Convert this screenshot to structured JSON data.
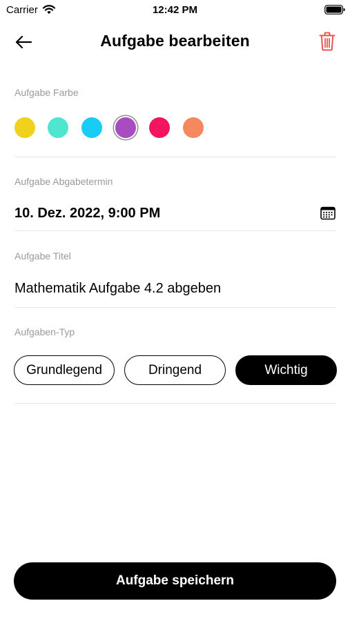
{
  "status_bar": {
    "carrier": "Carrier",
    "time": "12:42 PM"
  },
  "nav": {
    "title": "Aufgabe bearbeiten",
    "back_icon": "arrow-left-icon",
    "delete_icon": "trash-icon",
    "delete_color": "#e8554c"
  },
  "color_section": {
    "label": "Aufgabe Farbe",
    "swatches": [
      {
        "name": "yellow",
        "color": "#f0d21c"
      },
      {
        "name": "turquoise",
        "color": "#4ee6ce"
      },
      {
        "name": "cyan",
        "color": "#17cdf6"
      },
      {
        "name": "purple",
        "color": "#a94cc2",
        "selected": true
      },
      {
        "name": "pink",
        "color": "#f5155f"
      },
      {
        "name": "orange",
        "color": "#f5885f"
      }
    ]
  },
  "deadline_section": {
    "label": "Aufgabe Abgabetermin",
    "value": "10. Dez. 2022, 9:00 PM",
    "icon": "calendar-icon"
  },
  "title_section": {
    "label": "Aufgabe Titel",
    "value": "Mathematik Aufgabe 4.2 abgeben"
  },
  "type_section": {
    "label": "Aufgaben-Typ",
    "options": [
      {
        "label": "Grundlegend",
        "selected": false
      },
      {
        "label": "Dringend",
        "selected": false
      },
      {
        "label": "Wichtig",
        "selected": true
      }
    ]
  },
  "save_button": {
    "label": "Aufgabe speichern"
  }
}
